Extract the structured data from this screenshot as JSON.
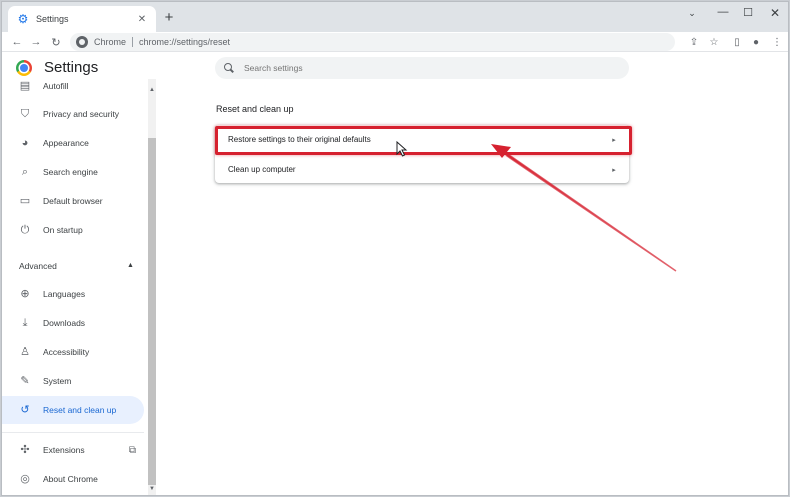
{
  "tab": {
    "title": "Settings"
  },
  "toolbar": {
    "chip": "Chrome",
    "url": "chrome://settings/reset"
  },
  "header": {
    "title": "Settings"
  },
  "search": {
    "placeholder": "Search settings"
  },
  "sidebar": {
    "items_top": [
      {
        "label": "Autofill",
        "icon": "autofill-icon"
      },
      {
        "label": "Privacy and security",
        "icon": "shield-icon"
      },
      {
        "label": "Appearance",
        "icon": "palette-icon"
      },
      {
        "label": "Search engine",
        "icon": "search-icon"
      },
      {
        "label": "Default browser",
        "icon": "browser-icon"
      },
      {
        "label": "On startup",
        "icon": "power-icon"
      }
    ],
    "advanced_label": "Advanced",
    "items_advanced": [
      {
        "label": "Languages",
        "icon": "globe-icon"
      },
      {
        "label": "Downloads",
        "icon": "download-icon"
      },
      {
        "label": "Accessibility",
        "icon": "accessibility-icon"
      },
      {
        "label": "System",
        "icon": "wrench-icon"
      },
      {
        "label": "Reset and clean up",
        "icon": "history-icon",
        "active": true
      }
    ],
    "items_bottom": [
      {
        "label": "Extensions",
        "icon": "puzzle-icon"
      },
      {
        "label": "About Chrome",
        "icon": "chrome-icon"
      }
    ]
  },
  "main": {
    "section_title": "Reset and clean up",
    "rows": [
      {
        "label": "Restore settings to their original defaults"
      },
      {
        "label": "Clean up computer"
      }
    ]
  },
  "colors": {
    "accent": "#1967d2",
    "highlight": "#d6212f",
    "active_bg": "#e8f0fe"
  }
}
